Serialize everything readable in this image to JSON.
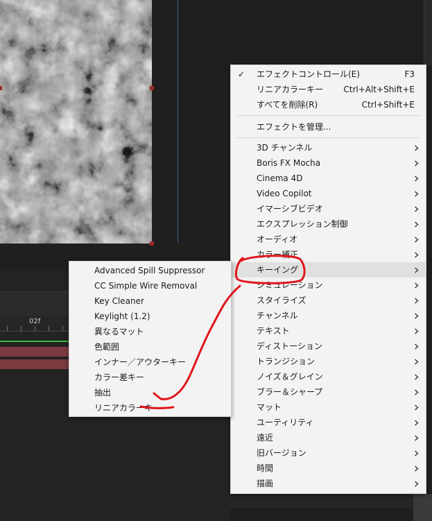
{
  "main_menu": {
    "top_items": [
      {
        "label": "エフェクトコントロール(E)",
        "shortcut": "F3",
        "checked": true
      },
      {
        "label": "リニアカラーキー",
        "shortcut": "Ctrl+Alt+Shift+E"
      },
      {
        "label": "すべてを削除(R)",
        "shortcut": "Ctrl+Shift+E"
      }
    ],
    "manage_item": {
      "label": "エフェクトを管理..."
    },
    "categories": [
      "3D チャンネル",
      "Boris FX Mocha",
      "Cinema 4D",
      "Video Copilot",
      "イマーシブビデオ",
      "エクスプレッション制御",
      "オーディオ",
      "カラー補正",
      "キーイング",
      "シミュレーション",
      "スタイライズ",
      "チャンネル",
      "テキスト",
      "ディストーション",
      "トランジション",
      "ノイズ＆グレイン",
      "ブラー＆シャープ",
      "マット",
      "ユーティリティ",
      "遠近",
      "旧バージョン",
      "時間",
      "描画"
    ],
    "highlighted_index": 8
  },
  "keying_submenu": {
    "items": [
      "Advanced Spill Suppressor",
      "CC Simple Wire Removal",
      "Key Cleaner",
      "Keylight (1.2)",
      "異なるマット",
      "色範囲",
      "インナー／アウターキー",
      "カラー差キー",
      "抽出",
      "リニアカラーキー"
    ]
  },
  "timeline": {
    "ruler_label": "02f"
  },
  "colors": {
    "menu_bg": "#f3f3f3",
    "highlight_bg": "#e0e0e0",
    "annotation_red": "#e0151b",
    "timeline_green": "#3fb63f",
    "layer_bar": "#7a3a3e"
  }
}
